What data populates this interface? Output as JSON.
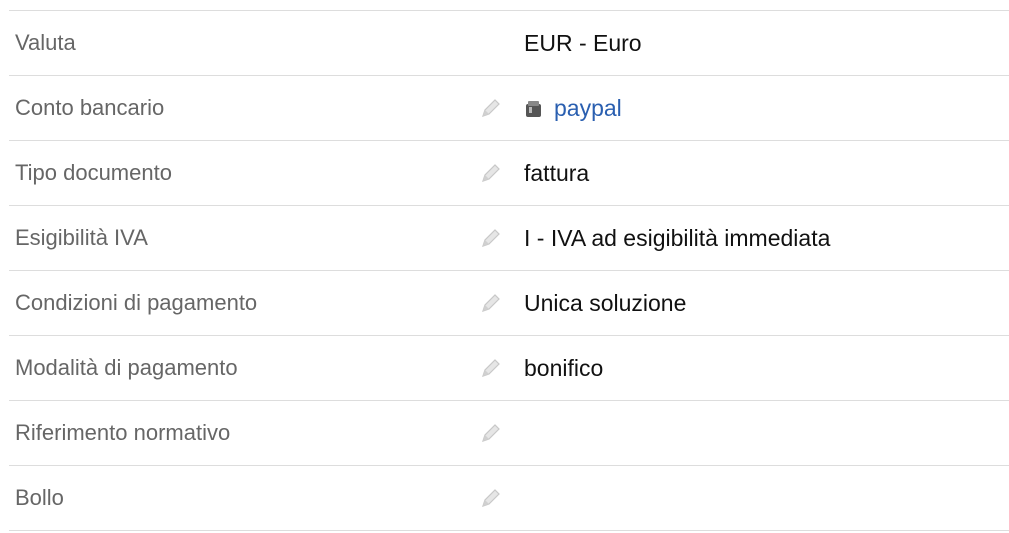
{
  "rows": [
    {
      "label": "Valuta",
      "editable": false,
      "value": "EUR - Euro"
    },
    {
      "label": "Conto bancario",
      "editable": true,
      "value": "paypal",
      "is_link": true,
      "icon": "bank-icon"
    },
    {
      "label": "Tipo documento",
      "editable": true,
      "value": "fattura"
    },
    {
      "label": "Esigibilità IVA",
      "editable": true,
      "value": "I - IVA ad esigibilità immediata"
    },
    {
      "label": "Condizioni di pagamento",
      "editable": true,
      "value": "Unica soluzione"
    },
    {
      "label": "Modalità di pagamento",
      "editable": true,
      "value": "bonifico"
    },
    {
      "label": "Riferimento normativo",
      "editable": true,
      "value": ""
    },
    {
      "label": "Bollo",
      "editable": true,
      "value": ""
    }
  ],
  "colors": {
    "label": "#666666",
    "value": "#111111",
    "link": "#2a5fb0",
    "divider": "#dddddd",
    "pencil": "#c8c8c8"
  }
}
